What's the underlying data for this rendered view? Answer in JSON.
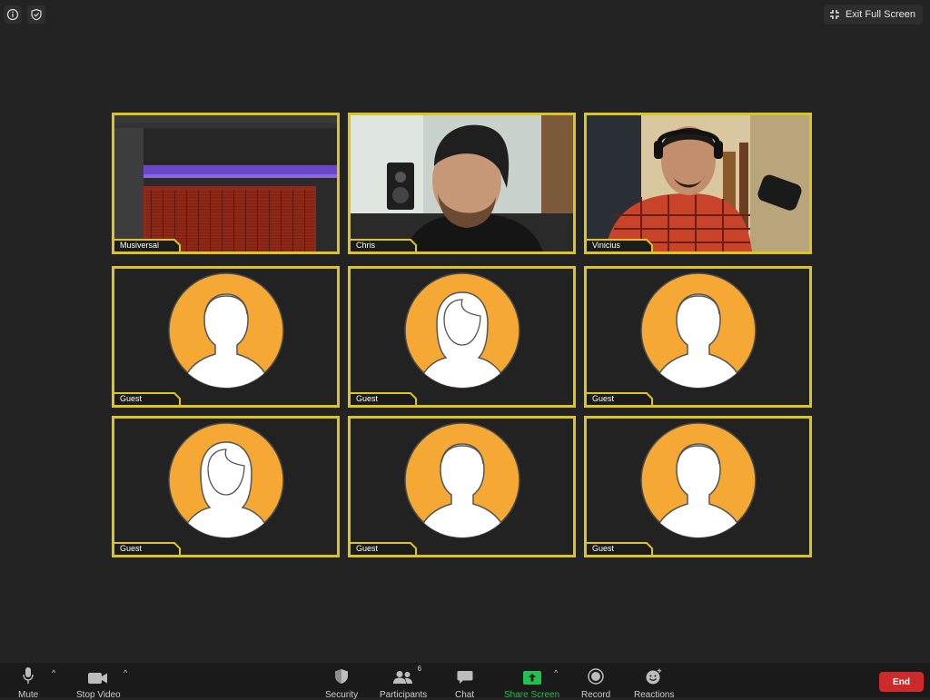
{
  "top": {
    "exit_fullscreen": "Exit Full Screen"
  },
  "participants": [
    {
      "name": "Musiversal",
      "kind": "screen-share"
    },
    {
      "name": "Chris",
      "kind": "video"
    },
    {
      "name": "Vinicius",
      "kind": "video"
    },
    {
      "name": "Guest",
      "kind": "avatar-male"
    },
    {
      "name": "Guest",
      "kind": "avatar-female"
    },
    {
      "name": "Guest",
      "kind": "avatar-male"
    },
    {
      "name": "Guest",
      "kind": "avatar-female"
    },
    {
      "name": "Guest",
      "kind": "avatar-male"
    },
    {
      "name": "Guest",
      "kind": "avatar-male"
    }
  ],
  "toolbar": {
    "mute": "Mute",
    "stop_video": "Stop Video",
    "security": "Security",
    "participants": "Participants",
    "participants_count": "6",
    "chat": "Chat",
    "share_screen": "Share Screen",
    "record": "Record",
    "reactions": "Reactions",
    "end": "End"
  },
  "colors": {
    "background": "#232323",
    "active_border": "#dcc51e",
    "avatar_orange": "#f5a833",
    "share_green": "#22c04f",
    "end_red": "#cd2b2b"
  }
}
